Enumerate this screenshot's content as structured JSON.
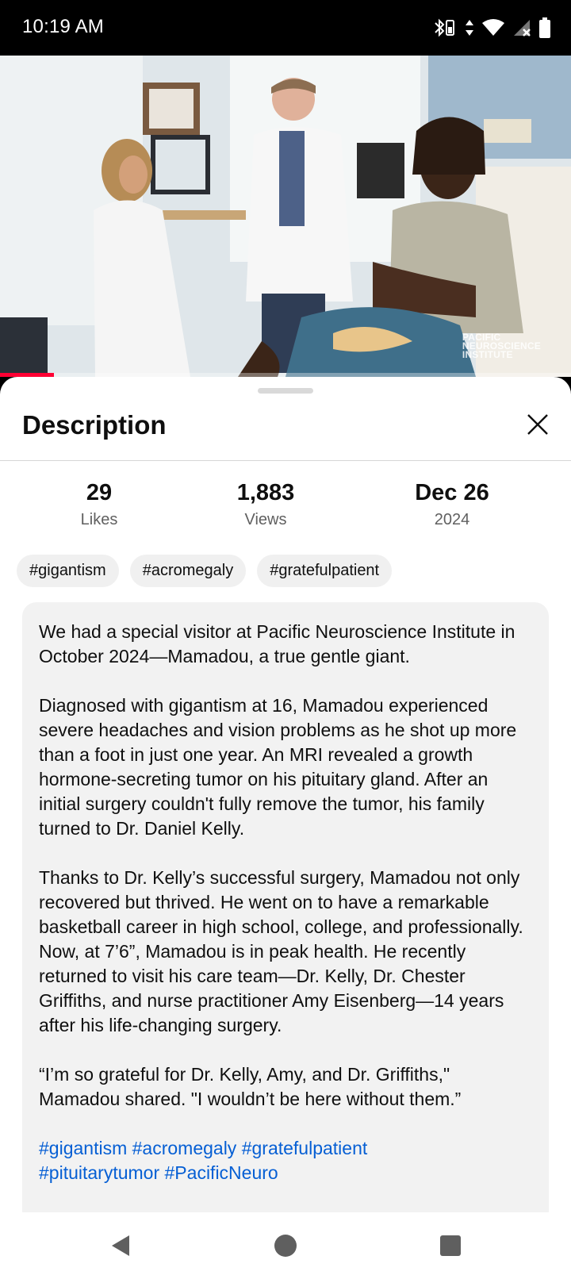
{
  "status_bar": {
    "time": "10:19 AM",
    "icons": [
      "bluetooth-battery-icon",
      "data-arrows-icon",
      "wifi-icon",
      "signal-icon",
      "battery-icon"
    ]
  },
  "video": {
    "watermark": [
      "PACIFIC",
      "NEUROSCIENCE",
      "INSTITUTE"
    ],
    "progress_fraction": 0.095,
    "progress_color": "#ff0033"
  },
  "sheet": {
    "title": "Description",
    "close_icon": "close-icon"
  },
  "stats": [
    {
      "value": "29",
      "label": "Likes"
    },
    {
      "value": "1,883",
      "label": "Views"
    },
    {
      "value": "Dec 26",
      "label": "2024"
    }
  ],
  "chips": [
    "#gigantism",
    "#acromegaly",
    "#gratefulpatient"
  ],
  "description": {
    "paragraphs": [
      "We had a special visitor at Pacific Neuroscience Institute in October 2024—Mamadou, a true gentle giant.",
      "Diagnosed with gigantism at 16, Mamadou experienced severe headaches and vision problems as he shot up more than a foot in just one year. An MRI revealed a growth hormone-secreting tumor on his pituitary gland. After an initial surgery couldn't fully remove the tumor, his family turned to Dr. Daniel Kelly.",
      "Thanks to Dr. Kelly’s successful surgery, Mamadou not only recovered but thrived. He went on to have a remarkable basketball career in high school, college, and professionally. Now, at 7’6”, Mamadou is in peak health. He recently returned to visit his care team—Dr. Kelly, Dr. Chester Griffiths, and nurse practitioner Amy Eisenberg—14 years after his life-changing surgery.",
      "“I’m so grateful for Dr. Kelly, Amy, and Dr. Griffiths,\" Mamadou shared. \"I wouldn’t be here without them.”"
    ],
    "hashtags": [
      "#gigantism",
      "#acromegaly",
      "#gratefulpatient",
      "#pituitarytumor",
      "#PacificNeuro"
    ],
    "link_color": "#065fd4"
  },
  "nav": [
    "back-icon",
    "home-icon",
    "recents-icon"
  ]
}
